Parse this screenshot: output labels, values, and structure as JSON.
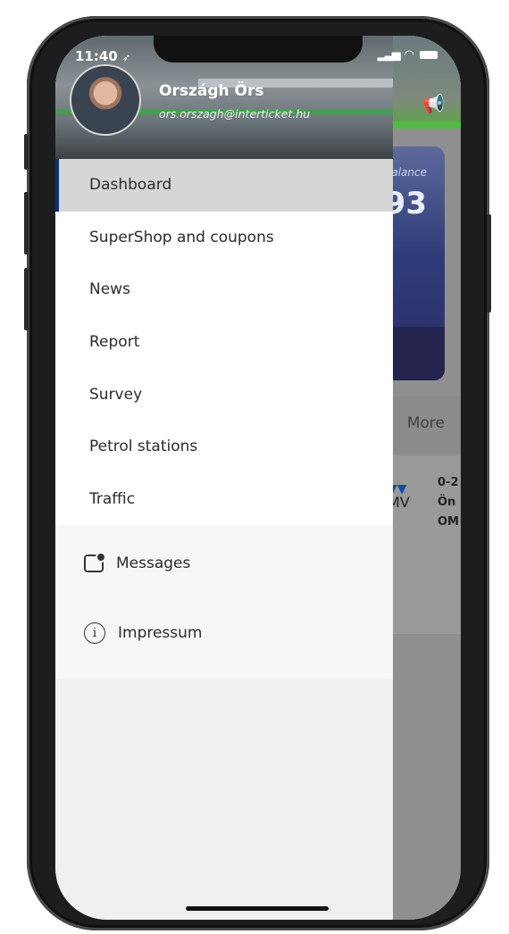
{
  "status_bar": {
    "time": "11:40",
    "location_glyph": "➶"
  },
  "profile": {
    "name": "Országh Örs",
    "email": "ors.orszagh@interticket.hu"
  },
  "menu": {
    "items": [
      {
        "label": "Dashboard",
        "active": true
      },
      {
        "label": "SuperShop and coupons"
      },
      {
        "label": "News"
      },
      {
        "label": "Report"
      },
      {
        "label": "Survey"
      },
      {
        "label": "Petrol stations"
      },
      {
        "label": "Traffic"
      }
    ],
    "secondary": [
      {
        "label": "Messages",
        "icon": "message-icon"
      },
      {
        "label": "Impressum",
        "icon": "info-icon"
      }
    ]
  },
  "background": {
    "card_label": "alance",
    "card_value": "93",
    "tab_more": "More",
    "omv_logo": "MV",
    "omv_lines": [
      "0-2",
      "Ön",
      "OM"
    ]
  },
  "colors": {
    "active_bar": "#0e2c73",
    "brand_green": "#55b948"
  }
}
